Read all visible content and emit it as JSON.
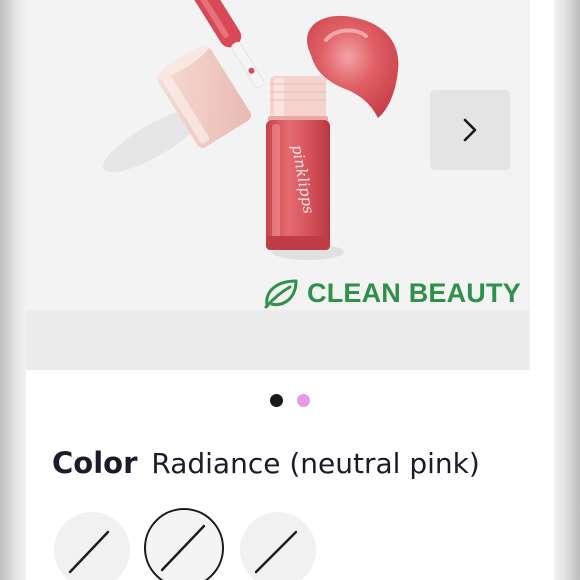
{
  "gallery": {
    "badge_text": "CLEAN BEAUTY",
    "brand_on_tube": "pinklipps",
    "next_icon": "chevron-right-icon",
    "dots": [
      {
        "state": "active",
        "color": "#1a1a1a"
      },
      {
        "state": "inactive",
        "color": "#ea9ae0"
      }
    ]
  },
  "color_selector": {
    "label": "Color",
    "selected_value": "Radiance (neutral pink)",
    "swatches": [
      {
        "state": "unselected",
        "icon": "unavailable-slash-icon"
      },
      {
        "state": "selected",
        "icon": "unavailable-slash-icon"
      },
      {
        "state": "unselected",
        "icon": "unavailable-slash-icon"
      }
    ]
  },
  "colors": {
    "badge_green": "#2f9149",
    "text_dark": "#1c1b2e",
    "lip_pink": "#d9555d"
  }
}
